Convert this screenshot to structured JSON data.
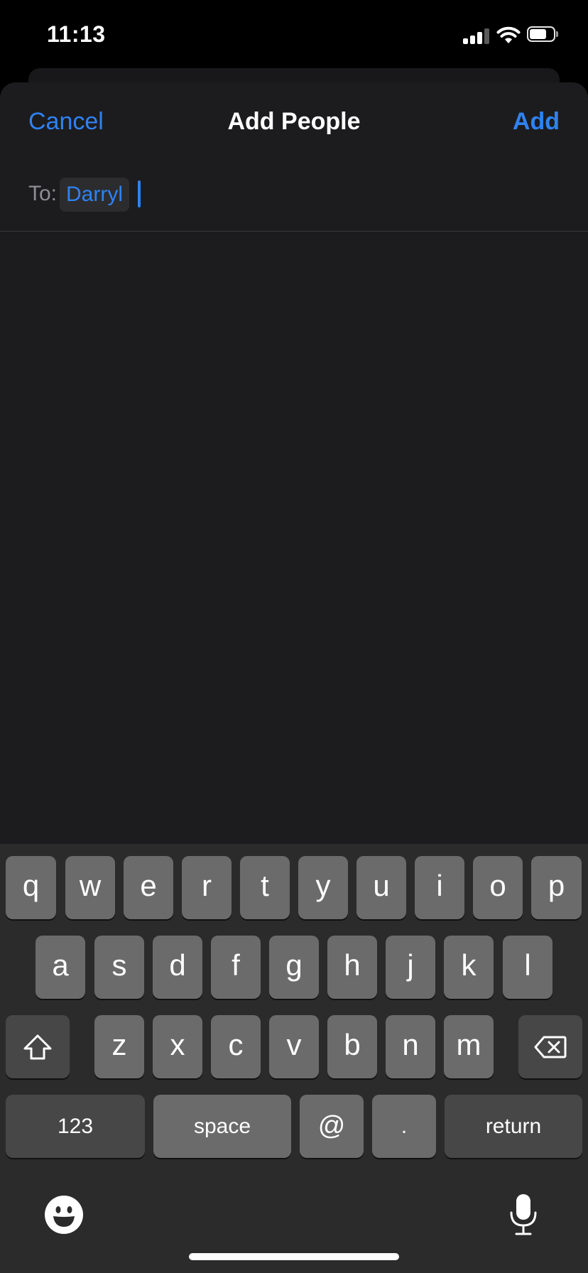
{
  "status_bar": {
    "time": "11:13"
  },
  "header": {
    "cancel": "Cancel",
    "title": "Add People",
    "add": "Add"
  },
  "recipients": {
    "label": "To:",
    "tokens": [
      "Darryl"
    ]
  },
  "keyboard": {
    "row1": [
      "q",
      "w",
      "e",
      "r",
      "t",
      "y",
      "u",
      "i",
      "o",
      "p"
    ],
    "row2": [
      "a",
      "s",
      "d",
      "f",
      "g",
      "h",
      "j",
      "k",
      "l"
    ],
    "row3": [
      "z",
      "x",
      "c",
      "v",
      "b",
      "n",
      "m"
    ],
    "numbers": "123",
    "space": "space",
    "at": "@",
    "dot": ".",
    "return": "return"
  },
  "colors": {
    "accent": "#2f82f2",
    "sheet": "#1c1c1e",
    "key": "#6b6b6b",
    "key_dark": "#474747"
  },
  "icons": [
    "shift-icon",
    "backspace-icon",
    "emoji-icon",
    "microphone-icon",
    "signal-icon",
    "wifi-icon",
    "battery-icon"
  ]
}
